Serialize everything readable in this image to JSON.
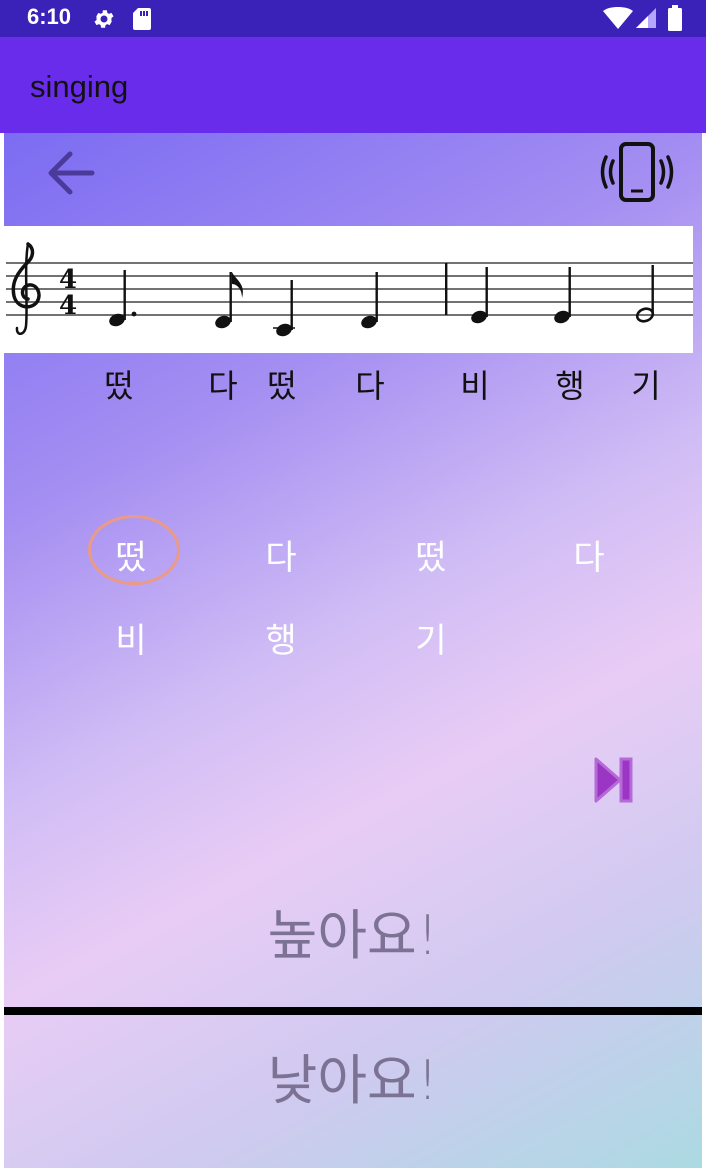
{
  "status_bar": {
    "time": "6:10",
    "icons": [
      "gear-icon",
      "sd-card-icon",
      "wifi-icon",
      "signal-icon",
      "battery-icon"
    ]
  },
  "app_bar": {
    "title": "singing"
  },
  "toolbar": {
    "back_icon": "arrow-left-icon",
    "vibrate_icon": "phone-vibrate-icon"
  },
  "score": {
    "clef": "treble",
    "time_signature": "4/4",
    "lyrics": [
      "떴",
      "다",
      "떴",
      "다",
      "비",
      "행",
      "기"
    ]
  },
  "practice": {
    "syllables_row1": [
      "떴",
      "다",
      "떴",
      "다"
    ],
    "syllables_row2": [
      "비",
      "행",
      "기"
    ],
    "active_index": 0
  },
  "controls": {
    "next_icon": "skip-next-icon"
  },
  "pitch": {
    "high_label": "높아요!",
    "low_label": "낮아요!"
  },
  "colors": {
    "status_bar": "#3a22b8",
    "app_bar": "#6a2ceb",
    "highlight": "#ea9a86",
    "next_button": "#9b36c4",
    "back_arrow": "#4a3a9a"
  }
}
